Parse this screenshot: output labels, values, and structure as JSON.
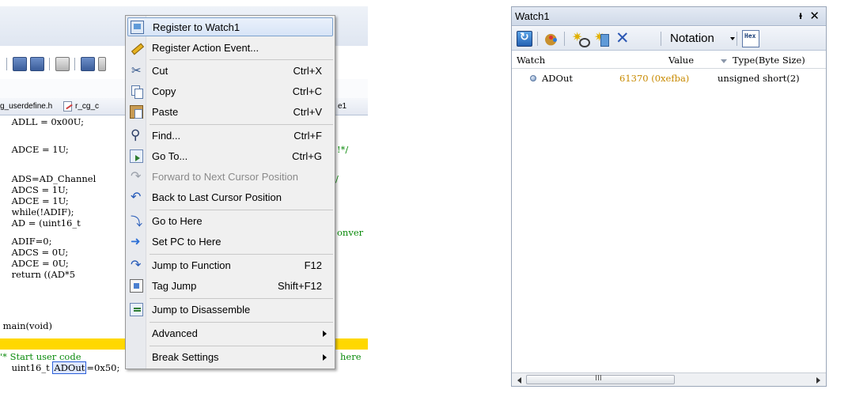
{
  "editor": {
    "tabs": [
      "g_userdefine.h",
      "r_cg_c",
      "e1"
    ],
    "code_lines": [
      "    ADLL = 0x00U;",
      "    ADCE = 1U;",
      "!*/",
      "    ADS=AD_Channel",
      "/",
      "    ADCS = 1U;",
      "    ADCE = 1U;",
      "    while(!ADIF);",
      "    AD = (uint16_t",
      "onver",
      "    ADIF=0;",
      "    ADCS = 0U;",
      "    ADCE = 0U;",
      "    return ((AD*5",
      " main(void)",
      "'* Start user code",
      "here",
      "    uint16_t ",
      "ADOut",
      "=0x50;"
    ]
  },
  "context_menu": {
    "items": [
      {
        "label": "Register to Watch1",
        "shortcut": "",
        "icon": "watch-icon"
      },
      {
        "label": "Register Action Event...",
        "shortcut": "",
        "icon": "pencil-icon"
      },
      {
        "label": "Cut",
        "shortcut": "Ctrl+X",
        "icon": "scissors-icon"
      },
      {
        "label": "Copy",
        "shortcut": "Ctrl+C",
        "icon": "copy-icon"
      },
      {
        "label": "Paste",
        "shortcut": "Ctrl+V",
        "icon": "paste-icon"
      },
      {
        "label": "Find...",
        "shortcut": "Ctrl+F",
        "icon": "binoculars-icon"
      },
      {
        "label": "Go To...",
        "shortcut": "Ctrl+G",
        "icon": "goto-icon"
      },
      {
        "label": "Forward to Next Cursor Position",
        "shortcut": "",
        "icon": "forward-icon"
      },
      {
        "label": "Back to Last Cursor Position",
        "shortcut": "",
        "icon": "back-icon"
      },
      {
        "label": "Go to Here",
        "shortcut": "",
        "icon": "go-here-icon"
      },
      {
        "label": "Set PC to Here",
        "shortcut": "",
        "icon": "set-pc-icon"
      },
      {
        "label": "Jump to Function",
        "shortcut": "F12",
        "icon": "jump-function-icon"
      },
      {
        "label": "Tag Jump",
        "shortcut": "Shift+F12",
        "icon": "tag-jump-icon"
      },
      {
        "label": "Jump to Disassemble",
        "shortcut": "",
        "icon": "disassemble-icon"
      },
      {
        "label": "Advanced",
        "shortcut": "",
        "icon": ""
      },
      {
        "label": "Break Settings",
        "shortcut": "",
        "icon": ""
      }
    ]
  },
  "watch": {
    "title": "Watch1",
    "pin_glyph": "q",
    "close_glyph": "✕",
    "notation_label": "Notation",
    "hex_label": "Hex",
    "columns": {
      "watch": "Watch",
      "value": "Value",
      "type": "Type(Byte Size)"
    },
    "rows": [
      {
        "name": "ADOut",
        "value": "61370 (0xefba)",
        "type": "unsigned short(2)"
      }
    ],
    "scroll_thumb_glyph": "III"
  },
  "colors": {
    "value_text": "#c88a00",
    "comment_green": "#0a8a0a",
    "highlight_yellow": "#ffd800",
    "menu_highlight_border": "#7da2ce"
  }
}
